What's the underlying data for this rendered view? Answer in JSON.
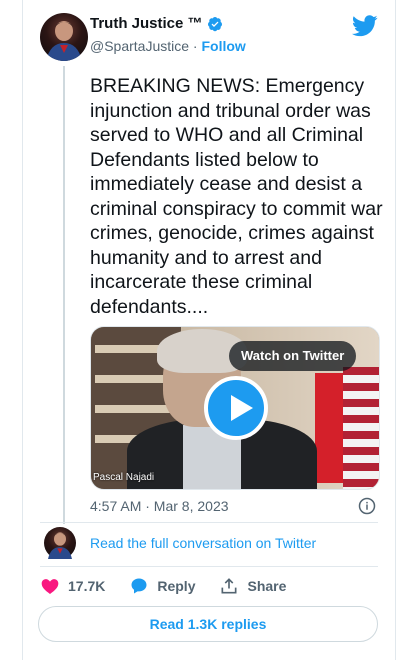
{
  "author": {
    "display_name": "Truth Justice ™",
    "handle": "@SpartaJustice",
    "separator": " · ",
    "follow_label": "Follow",
    "verified": true
  },
  "tweet": {
    "text": "BREAKING NEWS: Emergency injunction and tribunal order was served to WHO and all Criminal Defendants listed below to immediately cease and desist a criminal conspiracy to commit war crimes, genocide, crimes against humanity and to arrest and incarcerate these criminal defendants....",
    "timestamp": "4:57 AM · Mar 8, 2023"
  },
  "media": {
    "watch_label": "Watch on Twitter",
    "caption": "Pascal Najadi"
  },
  "conversation": {
    "link_text": "Read the full conversation on Twitter"
  },
  "actions": {
    "likes": "17.7K",
    "reply_label": "Reply",
    "share_label": "Share",
    "read_replies_label": "Read 1.3K replies"
  },
  "colors": {
    "accent": "#1d9bf0",
    "like": "#f91880",
    "text": "#0f1419",
    "muted": "#536471"
  },
  "icons": [
    "verified-badge-icon",
    "twitter-bird-icon",
    "play-icon",
    "info-icon",
    "heart-icon",
    "reply-bubble-icon",
    "share-icon"
  ]
}
